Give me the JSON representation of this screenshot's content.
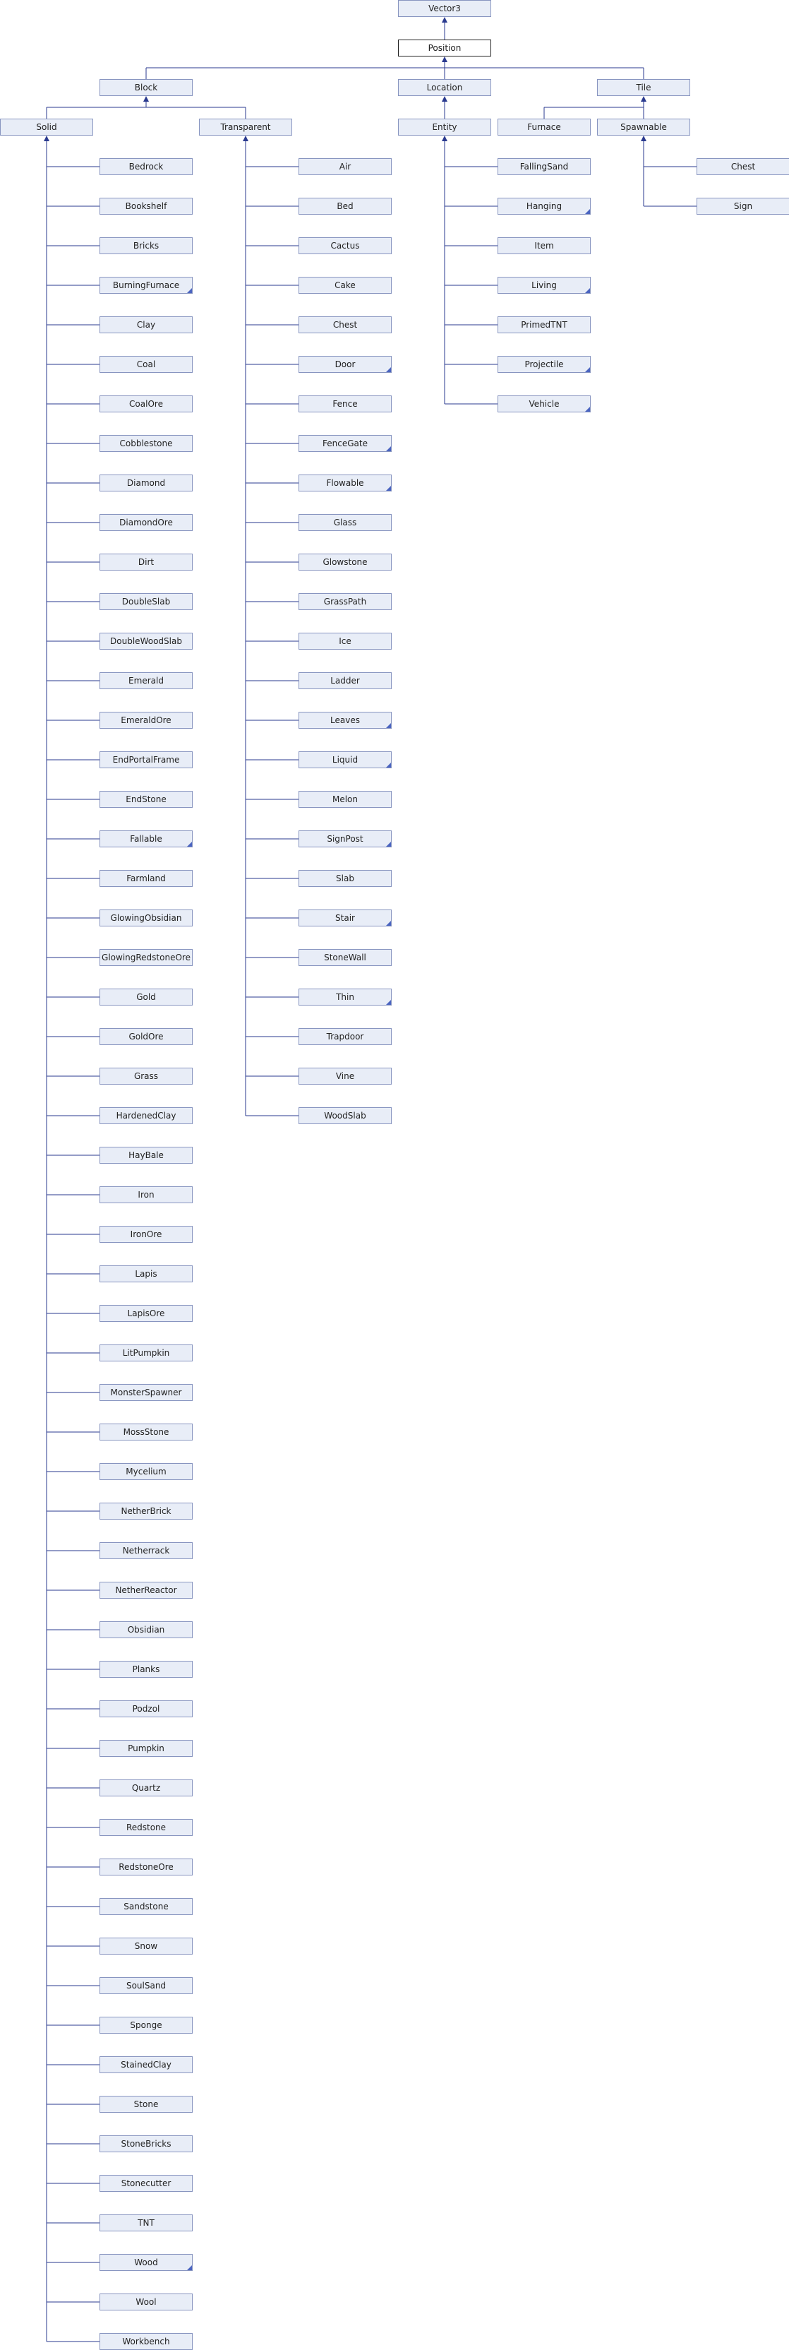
{
  "colors": {
    "node_fill": "#e8edf7",
    "node_border": "#8895c0",
    "edge": "#2a3a8f",
    "current_fill": "#ffffff",
    "current_border": "#222222"
  },
  "nodes": [
    {
      "id": "vector3",
      "label": "Vector3"
    },
    {
      "id": "position",
      "label": "Position",
      "current": true
    },
    {
      "id": "block",
      "label": "Block"
    },
    {
      "id": "location",
      "label": "Location"
    },
    {
      "id": "tile",
      "label": "Tile"
    },
    {
      "id": "solid",
      "label": "Solid"
    },
    {
      "id": "transparent",
      "label": "Transparent"
    },
    {
      "id": "entity",
      "label": "Entity"
    },
    {
      "id": "furnace",
      "label": "Furnace"
    },
    {
      "id": "spawnable",
      "label": "Spawnable"
    },
    {
      "id": "chest-tile",
      "label": "Chest"
    },
    {
      "id": "sign",
      "label": "Sign"
    },
    {
      "id": "bedrock",
      "label": "Bedrock"
    },
    {
      "id": "bookshelf",
      "label": "Bookshelf"
    },
    {
      "id": "bricks",
      "label": "Bricks"
    },
    {
      "id": "burning-furnace",
      "label": "BurningFurnace",
      "more": true
    },
    {
      "id": "clay",
      "label": "Clay"
    },
    {
      "id": "coal",
      "label": "Coal"
    },
    {
      "id": "coal-ore",
      "label": "CoalOre"
    },
    {
      "id": "cobblestone",
      "label": "Cobblestone"
    },
    {
      "id": "diamond",
      "label": "Diamond"
    },
    {
      "id": "diamond-ore",
      "label": "DiamondOre"
    },
    {
      "id": "dirt",
      "label": "Dirt"
    },
    {
      "id": "double-slab",
      "label": "DoubleSlab"
    },
    {
      "id": "double-wood-slab",
      "label": "DoubleWoodSlab"
    },
    {
      "id": "emerald",
      "label": "Emerald"
    },
    {
      "id": "emerald-ore",
      "label": "EmeraldOre"
    },
    {
      "id": "end-portal-frame",
      "label": "EndPortalFrame"
    },
    {
      "id": "end-stone",
      "label": "EndStone"
    },
    {
      "id": "fallable",
      "label": "Fallable",
      "more": true
    },
    {
      "id": "farmland",
      "label": "Farmland"
    },
    {
      "id": "glowing-obsidian",
      "label": "GlowingObsidian"
    },
    {
      "id": "glowing-redstone-ore",
      "label": "GlowingRedstoneOre"
    },
    {
      "id": "gold",
      "label": "Gold"
    },
    {
      "id": "gold-ore",
      "label": "GoldOre"
    },
    {
      "id": "grass",
      "label": "Grass"
    },
    {
      "id": "hardened-clay",
      "label": "HardenedClay"
    },
    {
      "id": "hay-bale",
      "label": "HayBale"
    },
    {
      "id": "iron",
      "label": "Iron"
    },
    {
      "id": "iron-ore",
      "label": "IronOre"
    },
    {
      "id": "lapis",
      "label": "Lapis"
    },
    {
      "id": "lapis-ore",
      "label": "LapisOre"
    },
    {
      "id": "lit-pumpkin",
      "label": "LitPumpkin"
    },
    {
      "id": "monster-spawner",
      "label": "MonsterSpawner"
    },
    {
      "id": "moss-stone",
      "label": "MossStone"
    },
    {
      "id": "mycelium",
      "label": "Mycelium"
    },
    {
      "id": "nether-brick",
      "label": "NetherBrick"
    },
    {
      "id": "netherrack",
      "label": "Netherrack"
    },
    {
      "id": "nether-reactor",
      "label": "NetherReactor"
    },
    {
      "id": "obsidian",
      "label": "Obsidian"
    },
    {
      "id": "planks",
      "label": "Planks"
    },
    {
      "id": "podzol",
      "label": "Podzol"
    },
    {
      "id": "pumpkin",
      "label": "Pumpkin"
    },
    {
      "id": "quartz",
      "label": "Quartz"
    },
    {
      "id": "redstone",
      "label": "Redstone"
    },
    {
      "id": "redstone-ore",
      "label": "RedstoneOre"
    },
    {
      "id": "sandstone",
      "label": "Sandstone"
    },
    {
      "id": "snow",
      "label": "Snow"
    },
    {
      "id": "soul-sand",
      "label": "SoulSand"
    },
    {
      "id": "sponge",
      "label": "Sponge"
    },
    {
      "id": "stained-clay",
      "label": "StainedClay"
    },
    {
      "id": "stone",
      "label": "Stone"
    },
    {
      "id": "stone-bricks",
      "label": "StoneBricks"
    },
    {
      "id": "stonecutter",
      "label": "Stonecutter"
    },
    {
      "id": "tnt",
      "label": "TNT"
    },
    {
      "id": "wood",
      "label": "Wood",
      "more": true
    },
    {
      "id": "wool",
      "label": "Wool"
    },
    {
      "id": "workbench",
      "label": "Workbench"
    },
    {
      "id": "air",
      "label": "Air"
    },
    {
      "id": "bed",
      "label": "Bed"
    },
    {
      "id": "cactus",
      "label": "Cactus"
    },
    {
      "id": "cake",
      "label": "Cake"
    },
    {
      "id": "chest-block",
      "label": "Chest"
    },
    {
      "id": "door",
      "label": "Door",
      "more": true
    },
    {
      "id": "fence",
      "label": "Fence"
    },
    {
      "id": "fence-gate",
      "label": "FenceGate",
      "more": true
    },
    {
      "id": "flowable",
      "label": "Flowable",
      "more": true
    },
    {
      "id": "glass",
      "label": "Glass"
    },
    {
      "id": "glowstone",
      "label": "Glowstone"
    },
    {
      "id": "grass-path",
      "label": "GrassPath"
    },
    {
      "id": "ice",
      "label": "Ice"
    },
    {
      "id": "ladder",
      "label": "Ladder"
    },
    {
      "id": "leaves",
      "label": "Leaves",
      "more": true
    },
    {
      "id": "liquid",
      "label": "Liquid",
      "more": true
    },
    {
      "id": "melon",
      "label": "Melon"
    },
    {
      "id": "sign-post",
      "label": "SignPost",
      "more": true
    },
    {
      "id": "slab",
      "label": "Slab"
    },
    {
      "id": "stair",
      "label": "Stair",
      "more": true
    },
    {
      "id": "stone-wall",
      "label": "StoneWall"
    },
    {
      "id": "thin",
      "label": "Thin",
      "more": true
    },
    {
      "id": "trapdoor",
      "label": "Trapdoor"
    },
    {
      "id": "vine",
      "label": "Vine"
    },
    {
      "id": "wood-slab",
      "label": "WoodSlab"
    },
    {
      "id": "falling-sand",
      "label": "FallingSand"
    },
    {
      "id": "hanging",
      "label": "Hanging",
      "more": true
    },
    {
      "id": "item",
      "label": "Item"
    },
    {
      "id": "living",
      "label": "Living",
      "more": true
    },
    {
      "id": "primed-tnt",
      "label": "PrimedTNT"
    },
    {
      "id": "projectile",
      "label": "Projectile",
      "more": true
    },
    {
      "id": "vehicle",
      "label": "Vehicle",
      "more": true
    }
  ],
  "edges": [
    [
      "vector3",
      "position"
    ],
    [
      "position",
      "block"
    ],
    [
      "position",
      "location"
    ],
    [
      "position",
      "tile"
    ],
    [
      "block",
      "solid"
    ],
    [
      "block",
      "transparent"
    ],
    [
      "location",
      "entity"
    ],
    [
      "tile",
      "furnace"
    ],
    [
      "tile",
      "spawnable"
    ],
    [
      "spawnable",
      "chest-tile"
    ],
    [
      "spawnable",
      "sign"
    ]
  ]
}
